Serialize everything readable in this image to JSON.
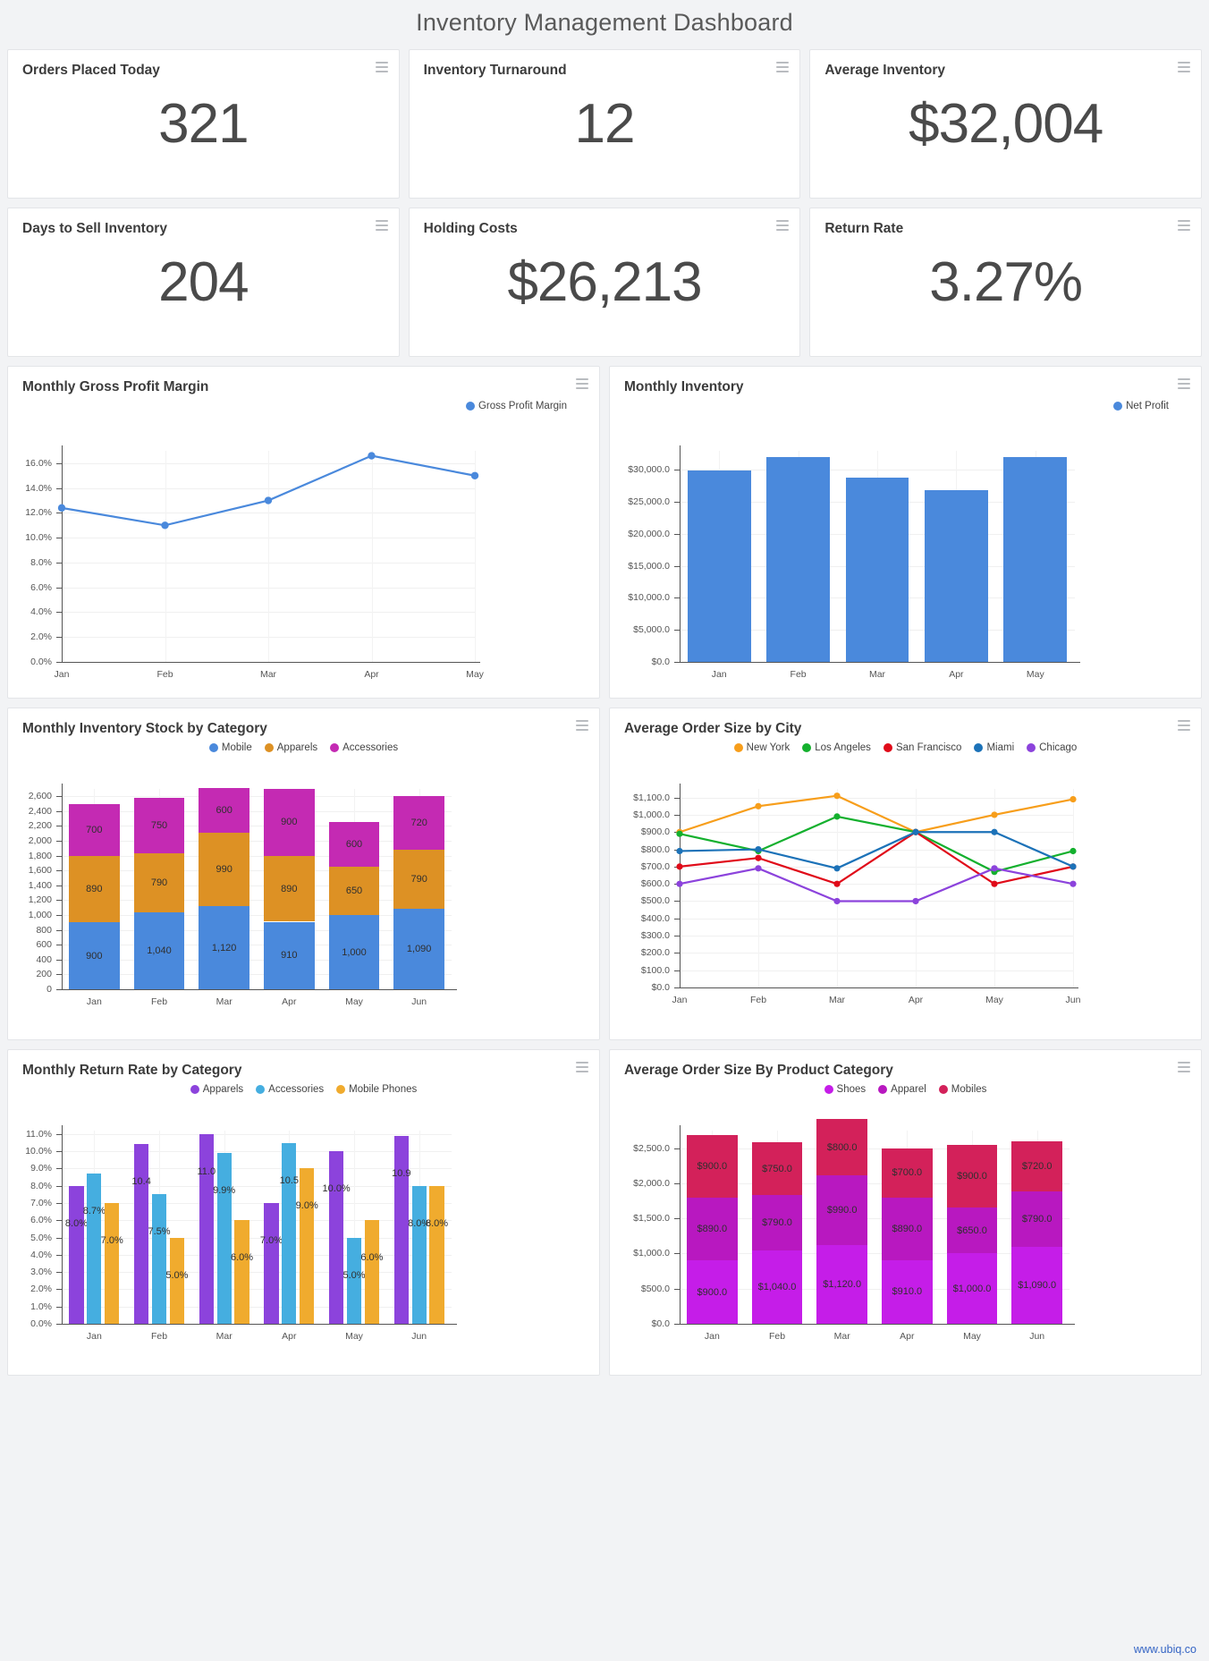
{
  "header": {
    "title": "Inventory Management Dashboard"
  },
  "menu_icon": "hamburger-menu-icon",
  "footer": {
    "url": "www.ubiq.co"
  },
  "kpis": [
    {
      "title": "Orders Placed Today",
      "value": "321"
    },
    {
      "title": "Inventory Turnaround",
      "value": "12"
    },
    {
      "title": "Average Inventory",
      "value": "$32,004"
    },
    {
      "title": "Days to Sell Inventory",
      "value": "204"
    },
    {
      "title": "Holding Costs",
      "value": "$26,213"
    },
    {
      "title": "Return Rate",
      "value": "3.27%"
    }
  ],
  "colors": {
    "blue": "#4a89dc",
    "orange": "#dd9124",
    "magenta": "#c42ab3",
    "green": "#14b02e",
    "red": "#e00b19",
    "steel": "#1c72b8",
    "purple": "#8c43dc",
    "skyblue": "#45aee0",
    "amber": "#f0ab2e",
    "crimson": "#d3215a",
    "violet": "#b818c0",
    "magenta2": "#c51de8",
    "nyorange": "#f79e1b"
  },
  "chart_data": [
    {
      "id": "gross-profit-margin",
      "type": "line",
      "title": "Monthly Gross Profit Margin",
      "legend": [
        "Gross Profit Margin"
      ],
      "legend_position": "top-right",
      "categories": [
        "Jan",
        "Feb",
        "Mar",
        "Apr",
        "May"
      ],
      "series": [
        {
          "name": "Gross Profit Margin",
          "color": "#4a89dc",
          "values": [
            12.4,
            11.0,
            13.0,
            16.6,
            15.0
          ]
        }
      ],
      "ylabel": "",
      "xlabel": "",
      "ylim": [
        0,
        17
      ],
      "yticks": [
        "0.0%",
        "2.0%",
        "4.0%",
        "6.0%",
        "8.0%",
        "10.0%",
        "12.0%",
        "14.0%",
        "16.0%"
      ],
      "ytick_values": [
        0,
        2,
        4,
        6,
        8,
        10,
        12,
        14,
        16
      ],
      "grid": true
    },
    {
      "id": "monthly-inventory",
      "type": "bar",
      "title": "Monthly Inventory",
      "legend": [
        "Net Profit"
      ],
      "legend_position": "top-right",
      "categories": [
        "Jan",
        "Feb",
        "Mar",
        "Apr",
        "May"
      ],
      "series": [
        {
          "name": "Net Profit",
          "color": "#4a89dc",
          "values": [
            29900,
            32000,
            28800,
            26900,
            32000
          ]
        }
      ],
      "ylim": [
        0,
        33000
      ],
      "yticks": [
        "$0.0",
        "$5,000.0",
        "$10,000.0",
        "$15,000.0",
        "$20,000.0",
        "$25,000.0",
        "$30,000.0"
      ],
      "ytick_values": [
        0,
        5000,
        10000,
        15000,
        20000,
        25000,
        30000
      ],
      "grid": true
    },
    {
      "id": "inventory-stock-by-category",
      "type": "bar",
      "stacked": true,
      "title": "Monthly Inventory Stock by Category",
      "legend": [
        "Mobile",
        "Apparels",
        "Accessories"
      ],
      "legend_position": "top-center",
      "categories": [
        "Jan",
        "Feb",
        "Mar",
        "Apr",
        "May",
        "Jun"
      ],
      "series": [
        {
          "name": "Mobile",
          "color": "#4a89dc",
          "values": [
            900,
            1040,
            1120,
            910,
            1000,
            1090
          ],
          "labels": [
            "900",
            "1,040",
            "1,120",
            "910",
            "1,000",
            "1,090"
          ]
        },
        {
          "name": "Apparels",
          "color": "#dd9124",
          "values": [
            890,
            790,
            990,
            890,
            650,
            790
          ],
          "labels": [
            "890",
            "790",
            "990",
            "890",
            "650",
            "790"
          ]
        },
        {
          "name": "Accessories",
          "color": "#c42ab3",
          "values": [
            700,
            750,
            600,
            900,
            600,
            720
          ],
          "labels": [
            "700",
            "750",
            "600",
            "900",
            "600",
            "720"
          ]
        }
      ],
      "ylim": [
        0,
        2700
      ],
      "yticks": [
        "0",
        "200",
        "400",
        "600",
        "800",
        "1,000",
        "1,200",
        "1,400",
        "1,600",
        "1,800",
        "2,000",
        "2,200",
        "2,400",
        "2,600"
      ],
      "ytick_values": [
        0,
        200,
        400,
        600,
        800,
        1000,
        1200,
        1400,
        1600,
        1800,
        2000,
        2200,
        2400,
        2600
      ],
      "grid": true
    },
    {
      "id": "avg-order-size-by-city",
      "type": "line",
      "title": "Average Order Size by City",
      "legend": [
        "New York",
        "Los Angeles",
        "San Francisco",
        "Miami",
        "Chicago"
      ],
      "legend_position": "top-center",
      "categories": [
        "Jan",
        "Feb",
        "Mar",
        "Apr",
        "May",
        "Jun"
      ],
      "series": [
        {
          "name": "New York",
          "color": "#f79e1b",
          "values": [
            900,
            1050,
            1110,
            900,
            1000,
            1090
          ]
        },
        {
          "name": "Los Angeles",
          "color": "#14b02e",
          "values": [
            890,
            790,
            990,
            900,
            670,
            790
          ]
        },
        {
          "name": "San Francisco",
          "color": "#e00b19",
          "values": [
            700,
            750,
            600,
            900,
            600,
            700
          ]
        },
        {
          "name": "Miami",
          "color": "#1c72b8",
          "values": [
            790,
            800,
            690,
            900,
            900,
            700
          ]
        },
        {
          "name": "Chicago",
          "color": "#8c43dc",
          "values": [
            600,
            690,
            500,
            500,
            690,
            600
          ]
        }
      ],
      "ylim": [
        0,
        1150
      ],
      "yticks": [
        "$0.0",
        "$100.0",
        "$200.0",
        "$300.0",
        "$400.0",
        "$500.0",
        "$600.0",
        "$700.0",
        "$800.0",
        "$900.0",
        "$1,000.0",
        "$1,100.0"
      ],
      "ytick_values": [
        0,
        100,
        200,
        300,
        400,
        500,
        600,
        700,
        800,
        900,
        1000,
        1100
      ],
      "grid": true
    },
    {
      "id": "return-rate-by-category",
      "type": "bar",
      "grouped": true,
      "title": "Monthly Return Rate by Category",
      "legend": [
        "Apparels",
        "Accessories",
        "Mobile Phones"
      ],
      "legend_position": "top-center",
      "categories": [
        "Jan",
        "Feb",
        "Mar",
        "Apr",
        "May",
        "Jun"
      ],
      "series": [
        {
          "name": "Apparels",
          "color": "#8c43dc",
          "values": [
            8.0,
            10.4,
            11.0,
            7.0,
            10.0,
            10.9
          ],
          "labels": [
            "8.0%",
            "10.4",
            "11.0",
            "7.0%",
            "10.0%",
            "10.9"
          ]
        },
        {
          "name": "Accessories",
          "color": "#45aee0",
          "values": [
            8.7,
            7.5,
            9.9,
            10.5,
            5.0,
            8.0
          ],
          "labels": [
            "8.7%",
            "7.5%",
            "9.9%",
            "10.5",
            "5.0%",
            "8.0%"
          ]
        },
        {
          "name": "Mobile Phones",
          "color": "#f0ab2e",
          "values": [
            7.0,
            5.0,
            6.0,
            9.0,
            6.0,
            8.0
          ],
          "labels": [
            "7.0%",
            "5.0%",
            "6.0%",
            "9.0%",
            "6.0%",
            "8.0%"
          ]
        }
      ],
      "ylim": [
        0,
        11.2
      ],
      "yticks": [
        "0.0%",
        "1.0%",
        "2.0%",
        "3.0%",
        "4.0%",
        "5.0%",
        "6.0%",
        "7.0%",
        "8.0%",
        "9.0%",
        "10.0%",
        "11.0%"
      ],
      "ytick_values": [
        0,
        1,
        2,
        3,
        4,
        5,
        6,
        7,
        8,
        9,
        10,
        11
      ],
      "grid": true
    },
    {
      "id": "avg-order-size-by-product-category",
      "type": "bar",
      "stacked": true,
      "title": "Average Order Size By Product Category",
      "legend": [
        "Shoes",
        "Apparel",
        "Mobiles"
      ],
      "legend_position": "top-center",
      "categories": [
        "Jan",
        "Feb",
        "Mar",
        "Apr",
        "May",
        "Jun"
      ],
      "series": [
        {
          "name": "Shoes",
          "color": "#c51de8",
          "values": [
            900,
            1040,
            1120,
            910,
            1000,
            1090
          ],
          "labels": [
            "$900.0",
            "$1,040.0",
            "$1,120.0",
            "$910.0",
            "$1,000.0",
            "$1,090.0"
          ]
        },
        {
          "name": "Apparel",
          "color": "#b818c0",
          "values": [
            890,
            790,
            990,
            890,
            650,
            790
          ],
          "labels": [
            "$890.0",
            "$790.0",
            "$990.0",
            "$890.0",
            "$650.0",
            "$790.0"
          ]
        },
        {
          "name": "Mobiles",
          "color": "#d3215a",
          "values": [
            900,
            750,
            800,
            700,
            900,
            720
          ],
          "labels": [
            "$900.0",
            "$750.0",
            "$800.0",
            "$700.0",
            "$900.0",
            "$720.0"
          ]
        }
      ],
      "ylim": [
        0,
        2750
      ],
      "yticks": [
        "$0.0",
        "$500.0",
        "$1,000.0",
        "$1,500.0",
        "$2,000.0",
        "$2,500.0"
      ],
      "ytick_values": [
        0,
        500,
        1000,
        1500,
        2000,
        2500
      ],
      "grid": true
    }
  ]
}
